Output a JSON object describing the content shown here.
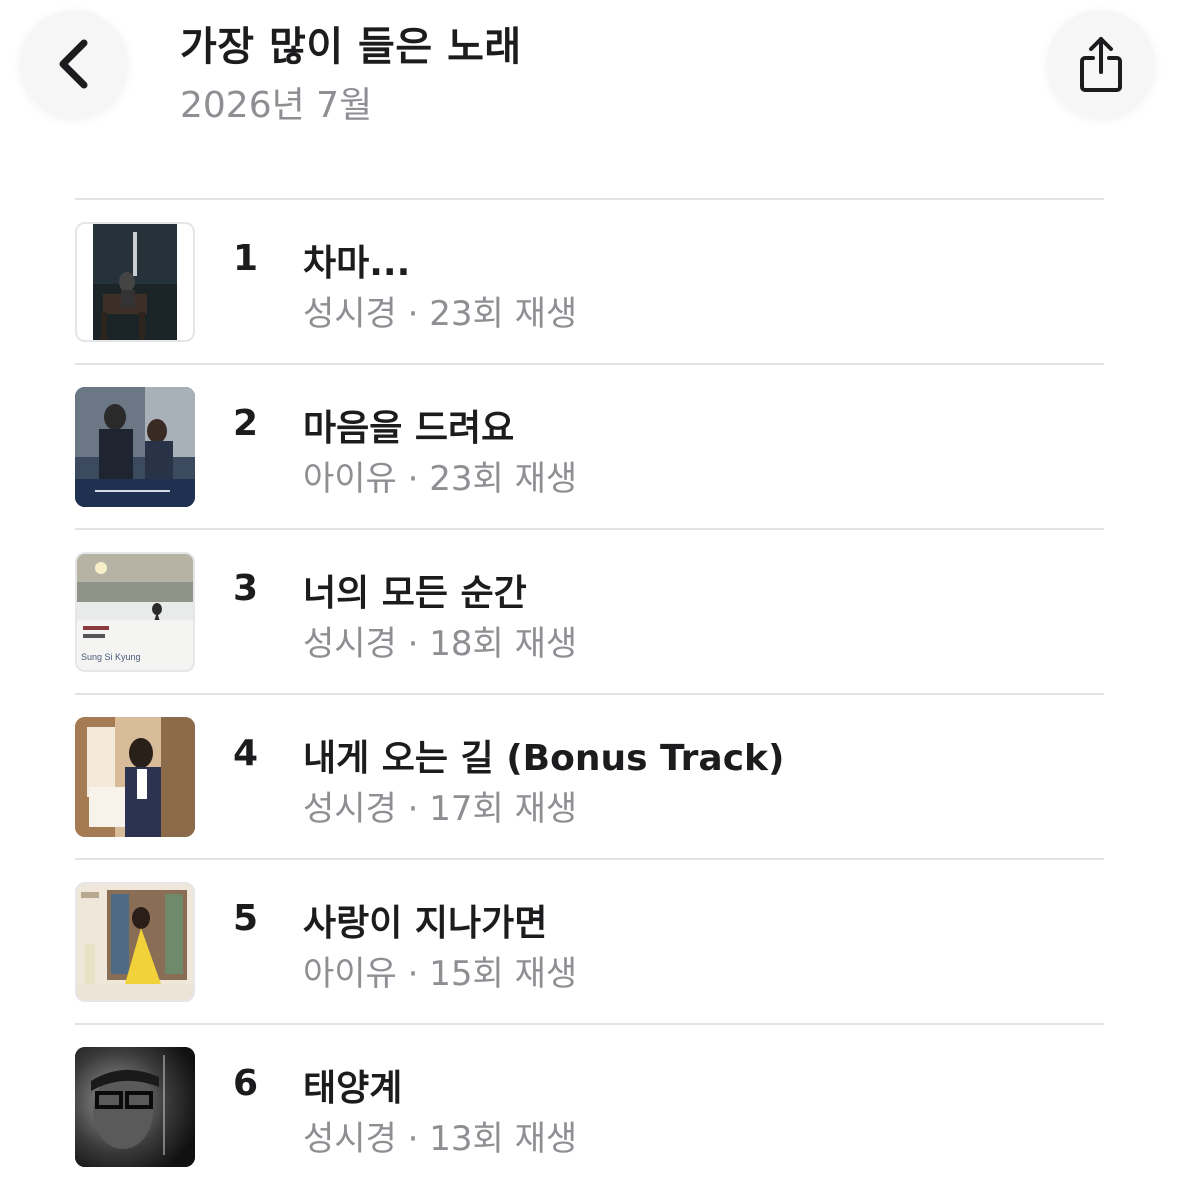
{
  "header": {
    "title": "가장 많이 들은 노래",
    "subtitle": "2026년 7월",
    "back_icon": "chevron-left-icon",
    "share_icon": "share-icon"
  },
  "tracks": [
    {
      "rank": "1",
      "title": "차마...",
      "artist": "성시경",
      "separator": " · ",
      "plays": "23회 재생"
    },
    {
      "rank": "2",
      "title": "마음을 드려요",
      "artist": "아이유",
      "separator": " · ",
      "plays": "23회 재생"
    },
    {
      "rank": "3",
      "title": "너의 모든 순간",
      "artist": "성시경",
      "separator": " · ",
      "plays": "18회 재생"
    },
    {
      "rank": "4",
      "title": "내게 오는 길 (Bonus Track)",
      "artist": "성시경",
      "separator": " · ",
      "plays": "17회 재생"
    },
    {
      "rank": "5",
      "title": "사랑이 지나가면",
      "artist": "아이유",
      "separator": " · ",
      "plays": "15회 재생"
    },
    {
      "rank": "6",
      "title": "태양계",
      "artist": "성시경",
      "separator": " · ",
      "plays": "13회 재생"
    }
  ],
  "artwork_text": {
    "art3_logo": "Sung Si Kyung"
  },
  "colors": {
    "primary_text": "#1c1c1e",
    "secondary_text": "#8e8e93",
    "divider": "#e3e3e6"
  }
}
